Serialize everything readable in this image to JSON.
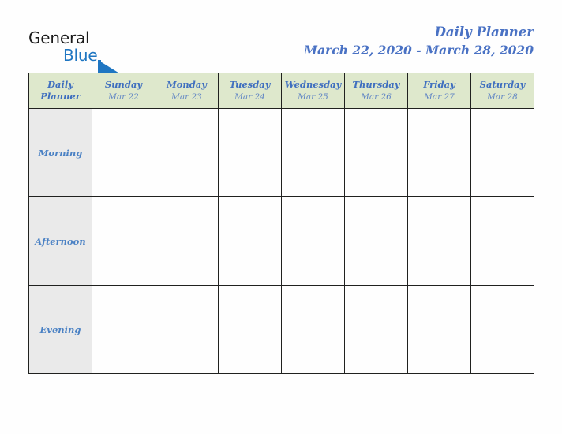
{
  "brand": {
    "name_part1": "General",
    "name_part2": "Blue",
    "triangle_color": "#1f76c2",
    "text_color": "#1b1b1b",
    "blue_color": "#1f76c2",
    "logo_icon": "triangle-flag-icon"
  },
  "header": {
    "title": "Daily Planner",
    "date_range": "March 22, 2020 - March 28, 2020",
    "title_color": "#4a72c4"
  },
  "table": {
    "corner_label_line1": "Daily",
    "corner_label_line2": "Planner",
    "header_bg": "#dee8cc",
    "row_label_bg": "#eaeaea",
    "border_color": "#20211f",
    "accent_blue": "#3f6fbf",
    "columns": [
      {
        "day": "Sunday",
        "date": "Mar 22"
      },
      {
        "day": "Monday",
        "date": "Mar 23"
      },
      {
        "day": "Tuesday",
        "date": "Mar 24"
      },
      {
        "day": "Wednesday",
        "date": "Mar 25"
      },
      {
        "day": "Thursday",
        "date": "Mar 26"
      },
      {
        "day": "Friday",
        "date": "Mar 27"
      },
      {
        "day": "Saturday",
        "date": "Mar 28"
      }
    ],
    "rows": [
      {
        "label": "Morning",
        "cells": [
          "",
          "",
          "",
          "",
          "",
          "",
          ""
        ]
      },
      {
        "label": "Afternoon",
        "cells": [
          "",
          "",
          "",
          "",
          "",
          "",
          ""
        ]
      },
      {
        "label": "Evening",
        "cells": [
          "",
          "",
          "",
          "",
          "",
          "",
          ""
        ]
      }
    ]
  }
}
